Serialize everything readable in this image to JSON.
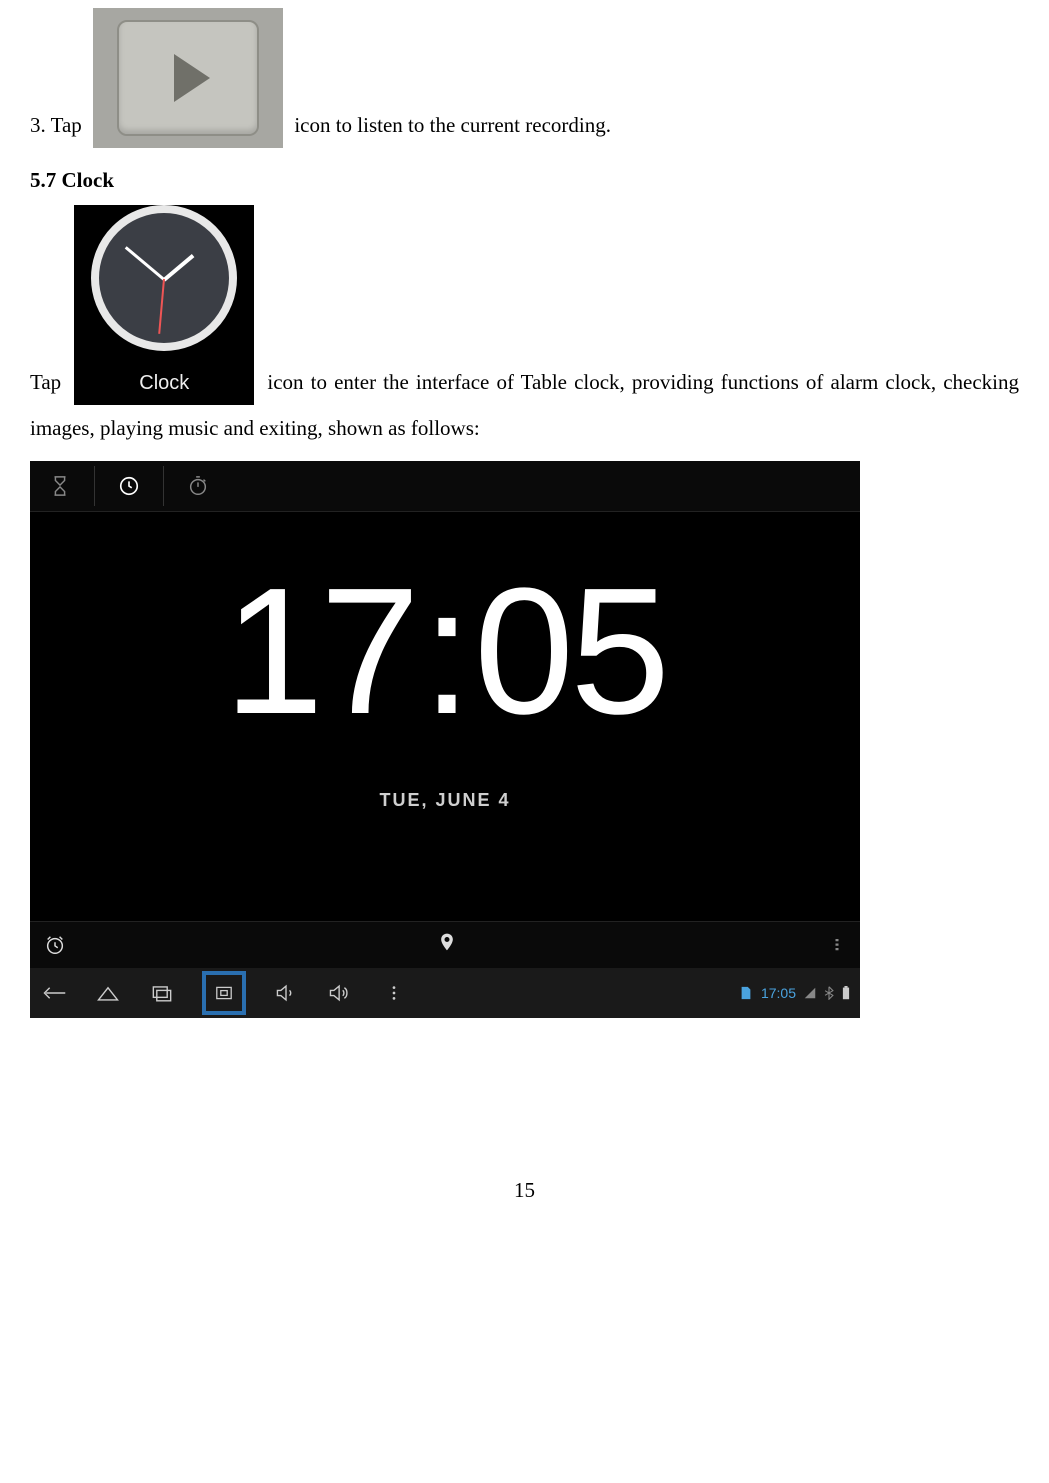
{
  "step3": {
    "prefix": "3. Tap",
    "suffix": "icon to listen to the current recording."
  },
  "section57": {
    "title": "5.7 Clock"
  },
  "clock_intro": {
    "prefix": "Tap",
    "suffix": "icon to enter the interface of Table clock, providing functions of alarm clock, checking images, playing music and exiting, shown as follows:"
  },
  "clock_icon_label": "Clock",
  "clock_ui": {
    "time_hours": "17",
    "time_minutes": "05",
    "date": "TUE, JUNE 4",
    "status_time": "17:05"
  },
  "page_number": "15"
}
